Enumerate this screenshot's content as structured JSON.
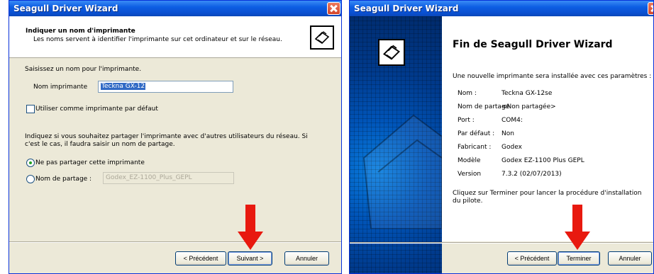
{
  "left": {
    "title": "Seagull Driver Wizard",
    "header_title": "Indiquer un nom d'imprimante",
    "header_subtitle": "Les noms servent à identifier l'imprimante sur cet ordinateur et sur le réseau.",
    "prompt": "Saisissez un nom pour l'imprimante.",
    "name_label": "Nom imprimante",
    "name_value": "Teckna GX-12",
    "default_label": "Utiliser comme imprimante par défaut",
    "share_text_1": "Indiquez si vous souhaitez partager l'imprimante avec d'autres utilisateurs du réseau. Si",
    "share_text_2": "c'est le cas, il faudra saisir un nom de partage.",
    "no_share_label": "Ne pas partager cette imprimante",
    "share_label": "Nom de partage :",
    "share_value": "Godex_EZ-1100_Plus_GEPL",
    "btn_prev": "< Précédent",
    "btn_next": "Suivant >",
    "btn_cancel": "Annuler"
  },
  "right": {
    "title": "Seagull Driver Wizard",
    "heading": "Fin de Seagull Driver Wizard",
    "intro": "Une nouvelle imprimante sera installée avec ces paramètres :",
    "props": [
      {
        "k": "Nom :",
        "v": "Teckna GX-12se"
      },
      {
        "k": "Nom de partage",
        "v": "<Non partagée>"
      },
      {
        "k": "Port :",
        "v": "COM4:"
      },
      {
        "k": "Par défaut :",
        "v": "Non"
      },
      {
        "k": "Fabricant :",
        "v": "Godex"
      },
      {
        "k": "Modèle",
        "v": "Godex EZ-1100 Plus GEPL"
      },
      {
        "k": "Version",
        "v": "7.3.2 (02/07/2013)"
      }
    ],
    "finish_1": "Cliquez sur Terminer pour lancer la procédure d'installation",
    "finish_2": "du pilote.",
    "btn_prev": "< Précédent",
    "btn_finish": "Terminer",
    "btn_cancel": "Annuler"
  },
  "colors": {
    "arrow": "#e8190f",
    "titlebar": "#0a4fd0"
  },
  "icons": [
    "printer-logo-icon",
    "close-icon",
    "red-arrow-icon"
  ]
}
